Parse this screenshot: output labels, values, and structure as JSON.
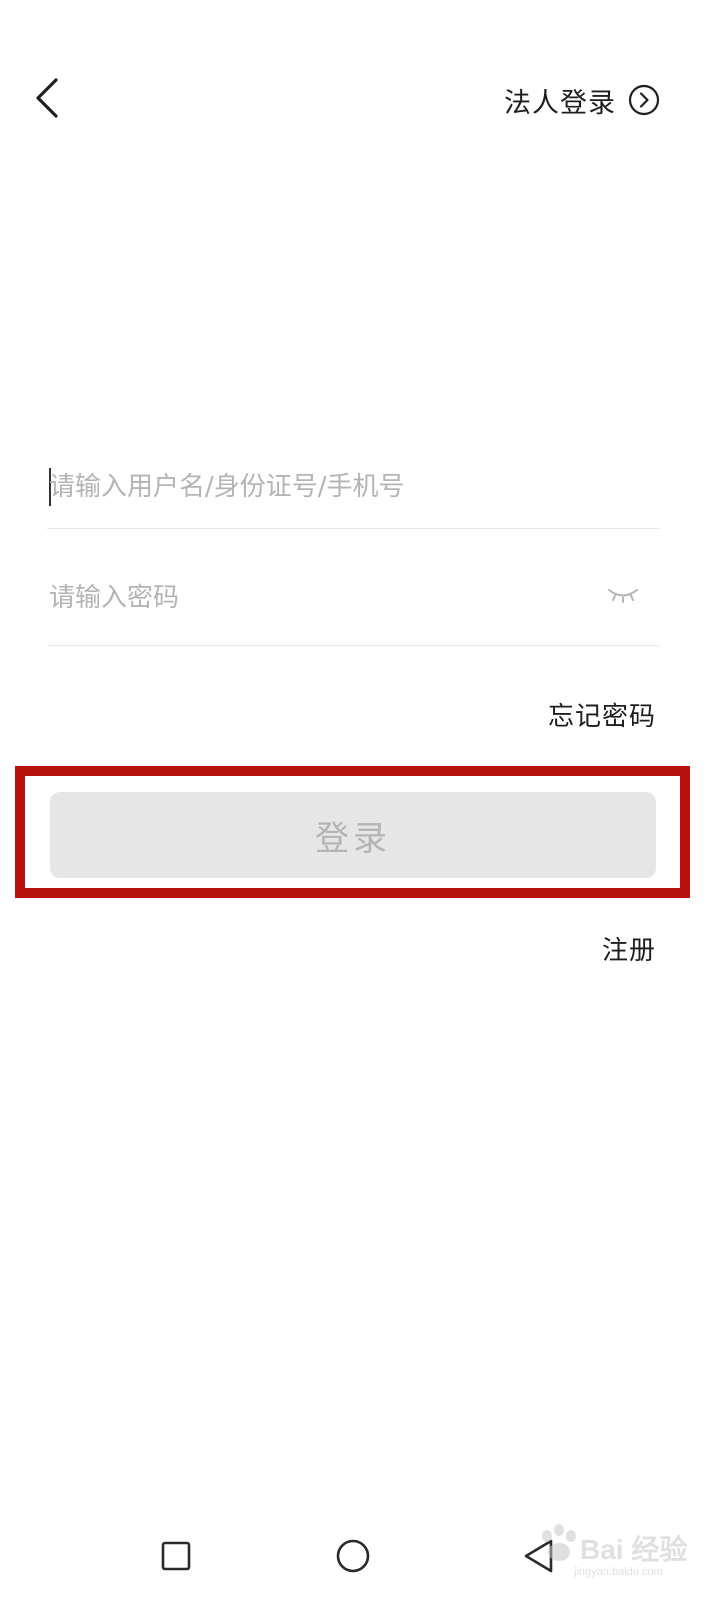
{
  "header": {
    "back_icon": "chevron-left-icon",
    "legal_login_label": "法人登录",
    "legal_login_icon": "circle-chevron-right-icon"
  },
  "form": {
    "username": {
      "value": "",
      "placeholder": "请输入用户名/身份证号/手机号"
    },
    "password": {
      "value": "",
      "placeholder": "请输入密码",
      "toggle_icon": "eye-closed-icon"
    },
    "forgot_label": "忘记密码",
    "login_label": "登录",
    "register_label": "注册"
  },
  "annotation": {
    "highlight_color": "#b8120e"
  },
  "colors": {
    "login_button_bg": "#e6e6e6",
    "login_button_text": "#b4b4b4",
    "placeholder": "#b4b4b4"
  },
  "system_nav": {
    "recent_icon": "square-icon",
    "home_icon": "circle-icon",
    "back_icon": "triangle-back-icon"
  },
  "watermark": {
    "brand": "Bai  经验",
    "url": "jingyan.baidu.com"
  }
}
